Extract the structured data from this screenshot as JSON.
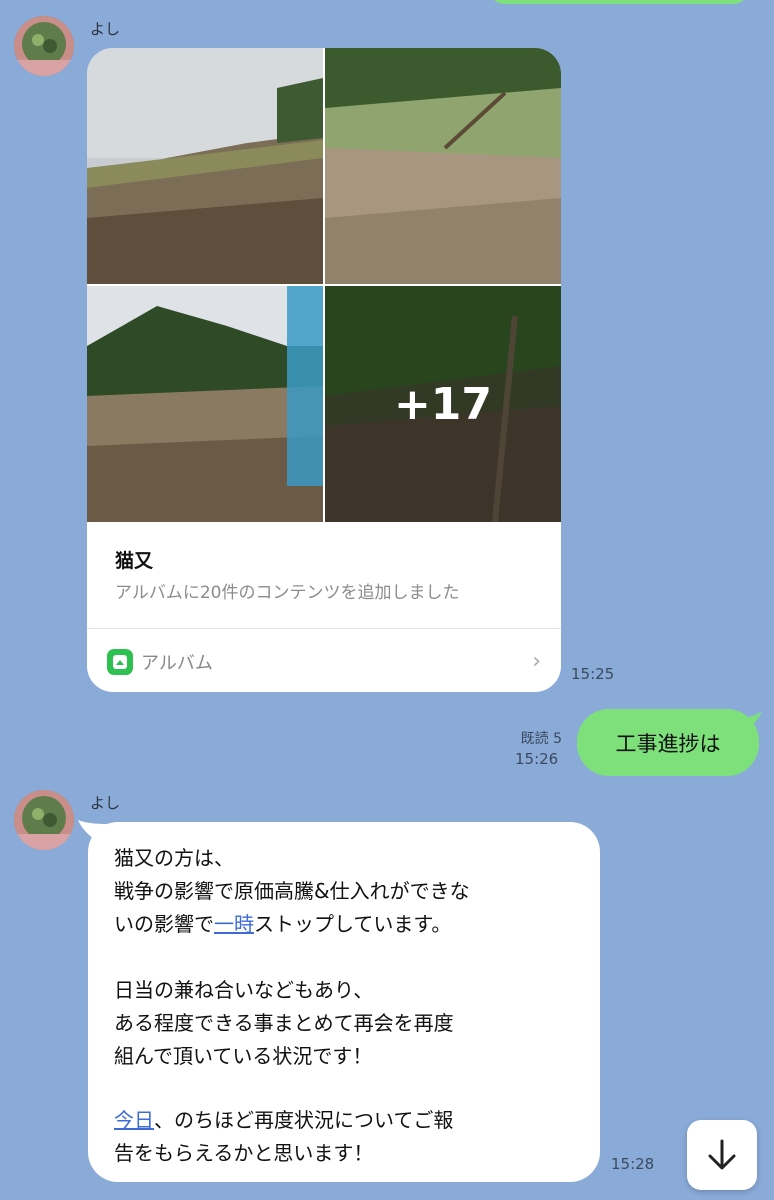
{
  "chat": {
    "messages": [
      {
        "sender": "よし",
        "type": "album",
        "album": {
          "more_count": "+17",
          "title": "猫又",
          "description": "アルバムに20件のコンテンツを追加しました",
          "footer_label": "アルバム"
        },
        "time": "15:25"
      },
      {
        "type": "outgoing",
        "text": "工事進捗は",
        "read_label": "既読 5",
        "time": "15:26"
      },
      {
        "sender": "よし",
        "type": "text",
        "lines": [
          "猫又の方は、",
          "戦争の影響で原価高騰&仕入れができな",
          "いの影響で",
          "一時",
          "ストップしています。",
          "日当の兼ね合いなどもあり、",
          "ある程度できる事まとめて再会を再度",
          "組んで頂いている状況です！",
          "今日",
          "、のちほど再度状況についてご報",
          "告をもらえるかと思います！"
        ],
        "time": "15:28"
      }
    ]
  },
  "icons": {
    "avatar": "avatar-icon",
    "album": "album-icon",
    "chevron": "chevron-right-icon",
    "scroll": "arrow-down-icon"
  },
  "colors": {
    "background": "#8aaad8",
    "outgoing_bubble": "#7de07b",
    "incoming_bubble": "#ffffff",
    "link": "#3e6bd6",
    "album_icon": "#2fc052"
  }
}
